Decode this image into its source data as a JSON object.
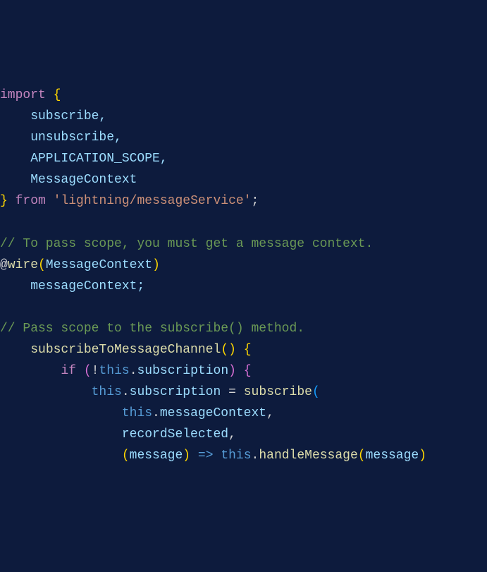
{
  "code": {
    "line1_import": "import",
    "line1_brace": " {",
    "line2": "    subscribe,",
    "line3": "    unsubscribe,",
    "line4": "    APPLICATION_SCOPE,",
    "line5": "    MessageContext",
    "line6_brace": "} ",
    "line6_from": "from",
    "line6_sp": " ",
    "line6_str": "'lightning/messageService'",
    "line6_semi": ";",
    "line8_comment": "// To pass scope, you must get a message context.",
    "line9_at": "@",
    "line9_wire": "wire",
    "line9_open": "(",
    "line9_arg": "MessageContext",
    "line9_close": ")",
    "line10": "    messageContext;",
    "line12_comment": "// Pass scope to the subscribe() method.",
    "line13_indent": "    ",
    "line13_method": "subscribeToMessageChannel",
    "line13_parens": "()",
    "line13_sp": " ",
    "line13_brace": "{",
    "line14_indent": "        ",
    "line14_if": "if",
    "line14_sp": " ",
    "line14_open": "(",
    "line14_not": "!",
    "line14_this": "this",
    "line14_dot": ".",
    "line14_prop": "subscription",
    "line14_close": ")",
    "line14_sp2": " ",
    "line14_brace": "{",
    "line15_indent": "            ",
    "line15_this": "this",
    "line15_dot": ".",
    "line15_prop": "subscription",
    "line15_sp": " ",
    "line15_eq": "=",
    "line15_sp2": " ",
    "line15_fn": "subscribe",
    "line15_open": "(",
    "line16_indent": "                ",
    "line16_this": "this",
    "line16_dot": ".",
    "line16_prop": "messageContext",
    "line16_comma": ",",
    "line17_indent": "                ",
    "line17_id": "recordSelected",
    "line17_comma": ",",
    "line18_indent": "                ",
    "line18_open": "(",
    "line18_param": "message",
    "line18_close": ")",
    "line18_sp": " ",
    "line18_arrow": "=>",
    "line18_sp2": " ",
    "line18_this": "this",
    "line18_dot": ".",
    "line18_method": "handleMessage",
    "line18_open2": "(",
    "line18_arg": "message",
    "line18_close2": ")"
  }
}
